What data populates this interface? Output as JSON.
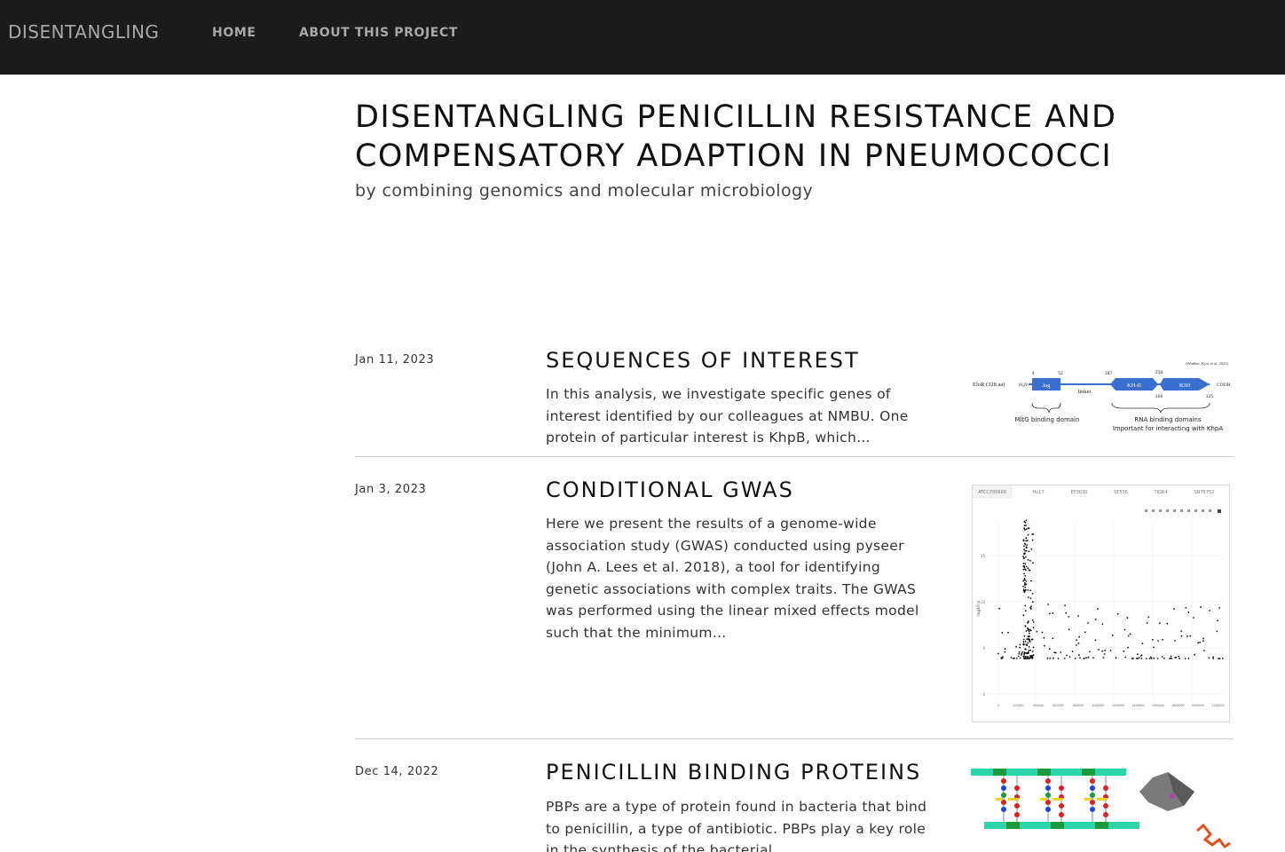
{
  "navbar": {
    "brand": "DISENTANGLING",
    "links": [
      "HOME",
      "ABOUT THIS PROJECT"
    ]
  },
  "header": {
    "title": "DISENTANGLING PENICILLIN RESISTANCE AND COMPENSATORY ADAPTION IN PNEUMOCOCCI",
    "subtitle": "by combining genomics and molecular microbiology"
  },
  "posts": [
    {
      "date": "Jan 11, 2023",
      "title": "SEQUENCES OF INTEREST",
      "excerpt": "In this analysis, we investigate specific genes of interest identified by our colleagues at NMBU. One protein of particular interest is KhpB, which…",
      "figure": {
        "protein_label": "EloR (328 aa)",
        "citation": "(Winther, Kjos et al. 2021)",
        "n_term": "H₂N",
        "c_term": "COOH",
        "domains": [
          "Jag",
          "KH-II",
          "R3H"
        ],
        "linker": "linker",
        "positions": [
          "4",
          "52",
          "187",
          "258",
          "268",
          "325"
        ],
        "brace_labels": [
          "MltG binding domain",
          "RNA binding domains",
          "Important for interacting with KhpA"
        ]
      }
    },
    {
      "date": "Jan 3, 2023",
      "title": "CONDITIONAL GWAS",
      "excerpt": "Here we present the results of a genome-wide association study (GWAS) conducted using pyseer (John A. Lees et al. 2018), a tool for identifying genetic associations with complex traits. The GWAS was performed using the linear mixed effects model such that the minimum…",
      "figure": {
        "tabs": [
          "ATCC700669",
          "Hu17",
          "EF3030",
          "ST556",
          "TIGR4",
          "SN75752"
        ],
        "ylabel": "-log10 p",
        "yticks": [
          "15",
          "10",
          "5",
          "0"
        ],
        "xticks": [
          "0",
          "200000",
          "400000",
          "600000",
          "800000",
          "1000000",
          "1200000",
          "1400000",
          "1600000",
          "1800000",
          "2000000",
          "2200000"
        ]
      }
    },
    {
      "date": "Dec 14, 2022",
      "title": "PENICILLIN BINDING PROTEINS",
      "excerpt": "PBPs are a type of protein found in bacteria that bind to penicillin, a type of antibiotic. PBPs play a key role in the synthesis of the bacterial…",
      "figure": {
        "colors": [
          "#2bd6a8",
          "#1a9a3a",
          "#e02020",
          "#2040e0",
          "#f0d020",
          "#7a7a7a",
          "#e0501a"
        ]
      }
    }
  ]
}
